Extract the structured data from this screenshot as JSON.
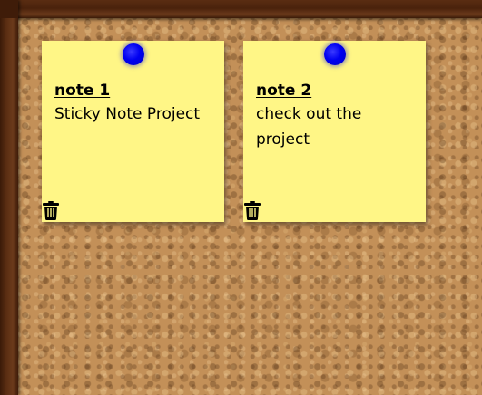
{
  "notes": [
    {
      "title": "note 1",
      "body": "Sticky Note Project",
      "pin_color": "#0000f0",
      "delete_icon": "trash-icon"
    },
    {
      "title": "note 2",
      "body": "check out the project",
      "pin_color": "#0000f0",
      "delete_icon": "trash-icon"
    }
  ],
  "colors": {
    "note_background": "#fff686",
    "frame": "#4a220c",
    "cork": "#c39058"
  }
}
